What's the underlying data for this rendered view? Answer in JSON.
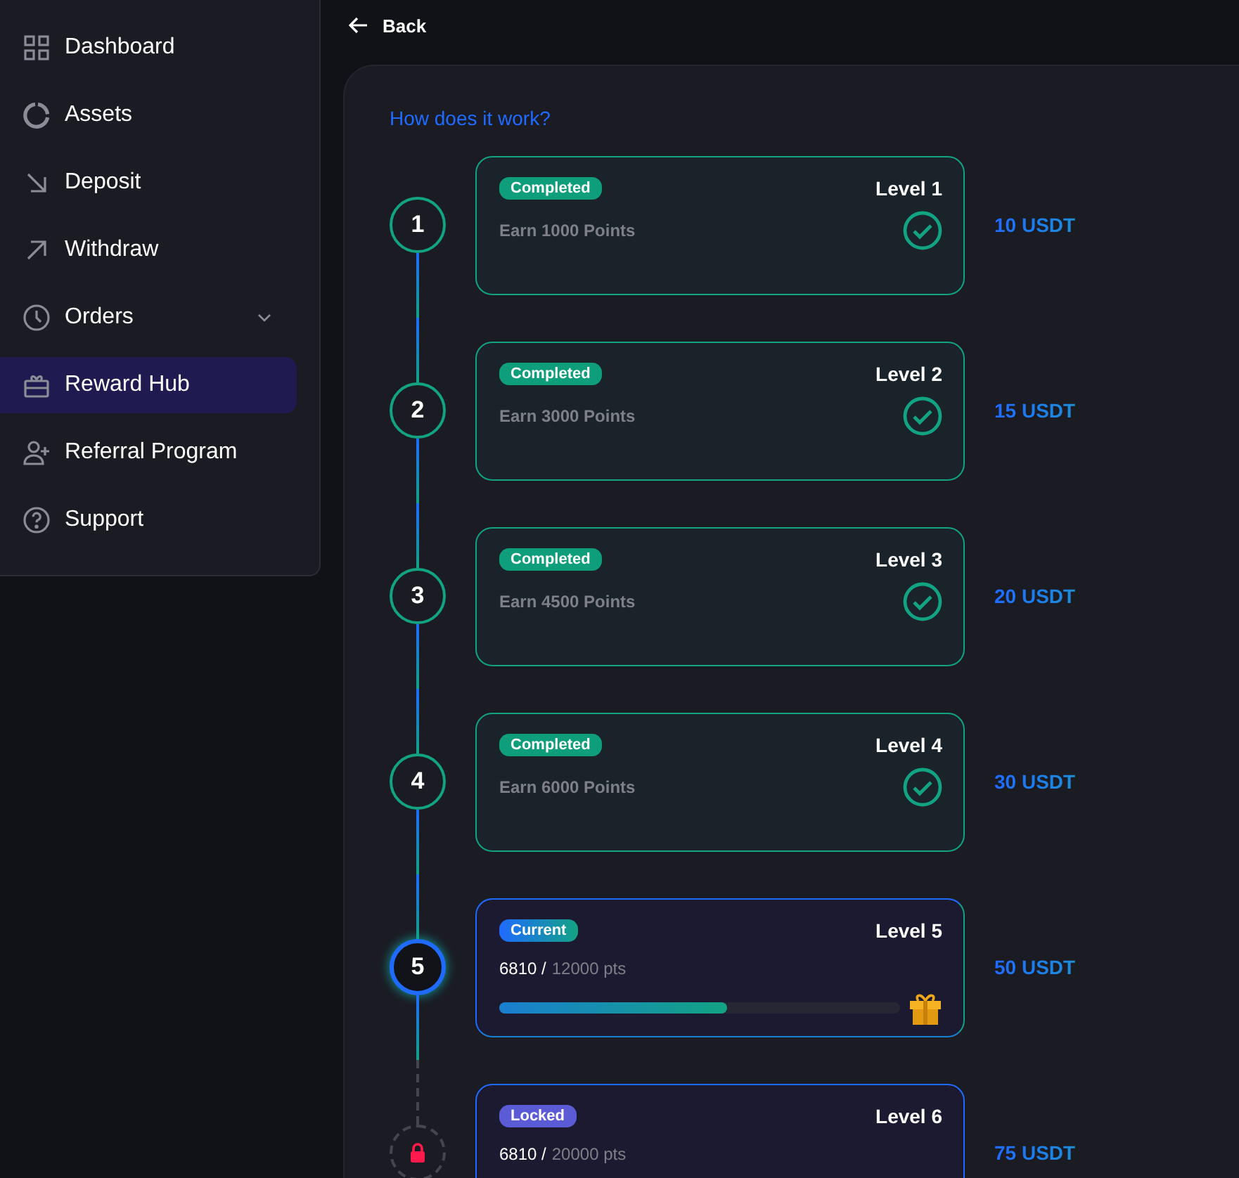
{
  "sidebar": {
    "items": [
      {
        "label": "Dashboard",
        "kind": "link",
        "selected": false
      },
      {
        "label": "Assets",
        "kind": "link",
        "selected": false
      },
      {
        "label": "Deposit",
        "kind": "link",
        "selected": false
      },
      {
        "label": "Withdraw",
        "kind": "link",
        "selected": false
      },
      {
        "label": "Orders",
        "kind": "group",
        "selected": false
      },
      {
        "label": "Reward Hub",
        "kind": "link",
        "selected": true
      },
      {
        "label": "Referral Program",
        "kind": "link",
        "selected": false
      },
      {
        "label": "Support",
        "kind": "link",
        "selected": false
      }
    ]
  },
  "back_button": "Back",
  "help_link": "How does it work?",
  "levels": [
    {
      "number": "1",
      "kind": "completed",
      "badge": "Completed",
      "title": "Level 1",
      "requirement": "Earn 1000 Points",
      "reward": "10 USDT"
    },
    {
      "number": "2",
      "kind": "completed",
      "badge": "Completed",
      "title": "Level 2",
      "requirement": "Earn 3000 Points",
      "reward": "15 USDT"
    },
    {
      "number": "3",
      "kind": "completed",
      "badge": "Completed",
      "title": "Level 3",
      "requirement": "Earn 4500 Points",
      "reward": "20 USDT"
    },
    {
      "number": "4",
      "kind": "completed",
      "badge": "Completed",
      "title": "Level 4",
      "requirement": "Earn 6000 Points",
      "reward": "30 USDT"
    },
    {
      "number": "5",
      "kind": "current",
      "badge": "Current",
      "title": "Level 5",
      "points": "6810 /",
      "goal": "12000 pts",
      "level": 0.5675,
      "reward": "50 USDT"
    },
    {
      "kind": "locked",
      "badge": "Locked",
      "title": "Level 6",
      "points": "6810 /",
      "goal": "20000 pts",
      "reward": "75 USDT"
    }
  ]
}
